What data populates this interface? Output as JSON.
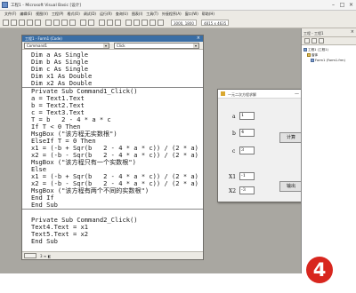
{
  "ide": {
    "title": "工程1 - Microsoft Visual Basic [设计]",
    "menu": [
      "文件(F)",
      "编辑(E)",
      "视图(V)",
      "工程(P)",
      "格式(O)",
      "调试(D)",
      "运行(R)",
      "查询(U)",
      "图表(I)",
      "工具(T)",
      "外接程序(A)",
      "窗口(W)",
      "帮助(H)"
    ],
    "toolbar_position": "3000, 1800",
    "toolbar_size": "4815 x 4635"
  },
  "code_window": {
    "title": "工程1 - Form1 (Code)",
    "object_combo": "Command1",
    "procedure_combo": "Click",
    "status": "3  ≡  ◧",
    "lines": [
      "Dim a As Single",
      "Dim b As Single",
      "Dim c As Single",
      "Dim x1 As Double",
      "Dim x2 As Double",
      "Private Sub Command1_Click()",
      "a = Text1.Text",
      "b = Text2.Text",
      "c = Text3.Text",
      "T = b   2 - 4 * a * c",
      "If T < 0 Then",
      "MsgBox (\"该方程无实数根\")",
      "ElseIf T = 0 Then",
      "x1 = (-b + Sqr(b   2 - 4 * a * c)) / (2 * a)",
      "x2 = (-b - Sqr(b   2 - 4 * a * c)) / (2 * a)",
      "MsgBox (\"该方程只有一个实数根\")",
      "Else",
      "x1 = (-b + Sqr(b   2 - 4 * a * c)) / (2 * a)",
      "x2 = (-b - Sqr(b   2 - 4 * a * c)) / (2 * a)",
      "MsgBox (\"该方程有两个不同的实数根\")",
      "End If",
      "End Sub",
      "",
      "Private Sub Command2_Click()",
      "Text4.Text = x1",
      "Text5.Text = x2",
      "End Sub"
    ]
  },
  "form_window": {
    "title": "一元二次方程求解",
    "label_a": "a",
    "label_b": "b",
    "label_c": "c",
    "label_x1": "X1",
    "label_x2": "X2",
    "text_a": "1",
    "text_b": "4",
    "text_c": "3",
    "text_x1": "-1",
    "text_x2": "-3",
    "button_compute": "计算",
    "button_output": "输出",
    "ctl_min": "—",
    "ctl_max": "□",
    "ctl_close": "×"
  },
  "project_panel": {
    "title": "工程 - 工程1",
    "close": "×",
    "tree_root": "工程1 (工程1)",
    "tree_folder": "窗体",
    "tree_form": "Form1 (Form1.frm)"
  },
  "step_badge": "4",
  "colors": {
    "badge": "#d8261e",
    "title_bar_active": "#3a6ea5"
  }
}
